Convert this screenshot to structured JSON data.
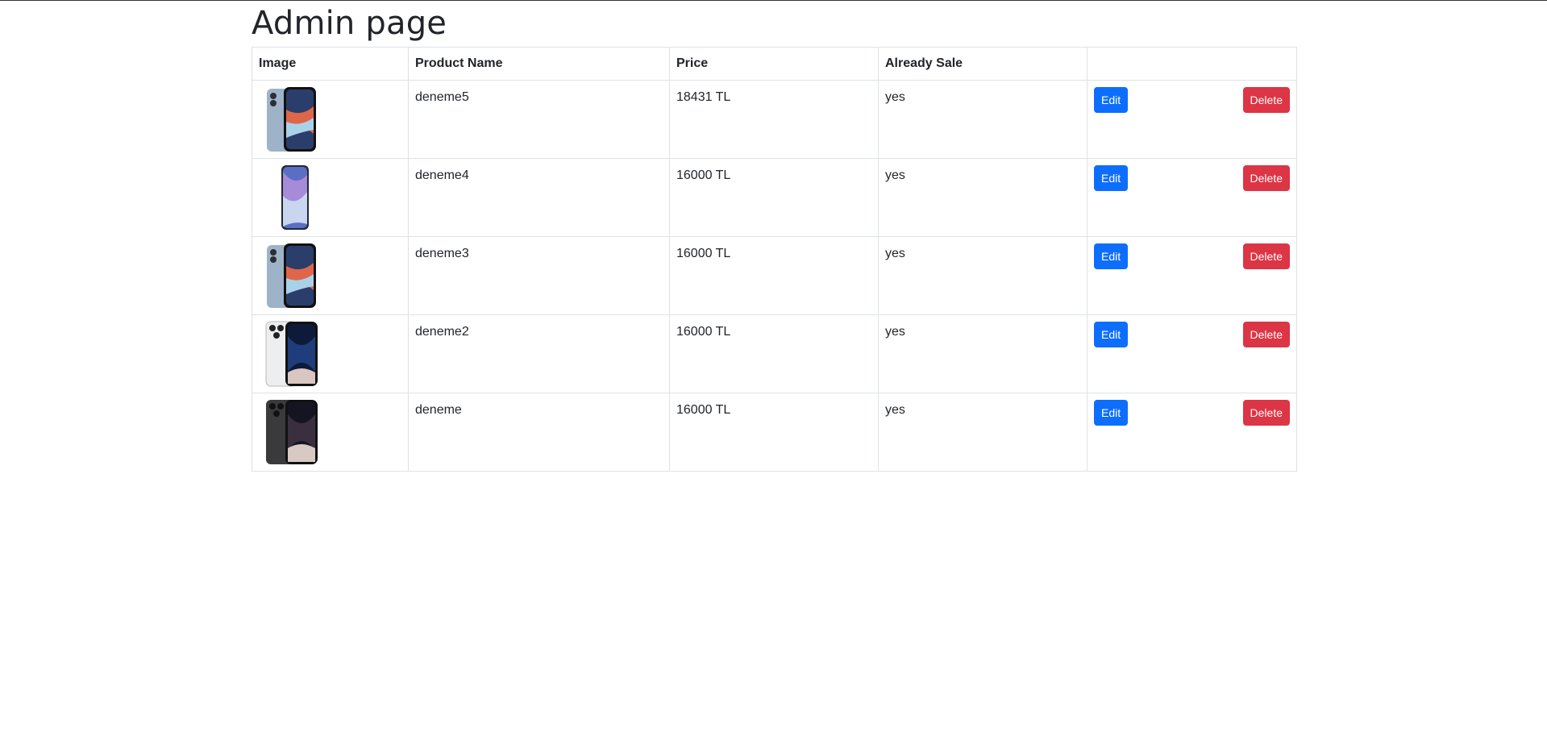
{
  "page": {
    "title": "Admin page"
  },
  "table": {
    "headers": [
      "Image",
      "Product Name",
      "Price",
      "Already Sale",
      ""
    ],
    "rows": [
      {
        "image": "iphone-14-blue",
        "name": "deneme5",
        "price": "18431 TL",
        "sale": "yes",
        "edit": "Edit",
        "delete": "Delete"
      },
      {
        "image": "galaxy-s21-fe",
        "name": "deneme4",
        "price": "16000 TL",
        "sale": "yes",
        "edit": "Edit",
        "delete": "Delete"
      },
      {
        "image": "iphone-14-blue",
        "name": "deneme3",
        "price": "16000 TL",
        "sale": "yes",
        "edit": "Edit",
        "delete": "Delete"
      },
      {
        "image": "iphone-14-pro-silver",
        "name": "deneme2",
        "price": "16000 TL",
        "sale": "yes",
        "edit": "Edit",
        "delete": "Delete"
      },
      {
        "image": "iphone-14-pro-black",
        "name": "deneme",
        "price": "16000 TL",
        "sale": "yes",
        "edit": "Edit",
        "delete": "Delete"
      }
    ]
  },
  "colors": {
    "edit": "#0d6efd",
    "delete": "#dc3545",
    "text": "#212529",
    "border": "#dee2e6"
  }
}
